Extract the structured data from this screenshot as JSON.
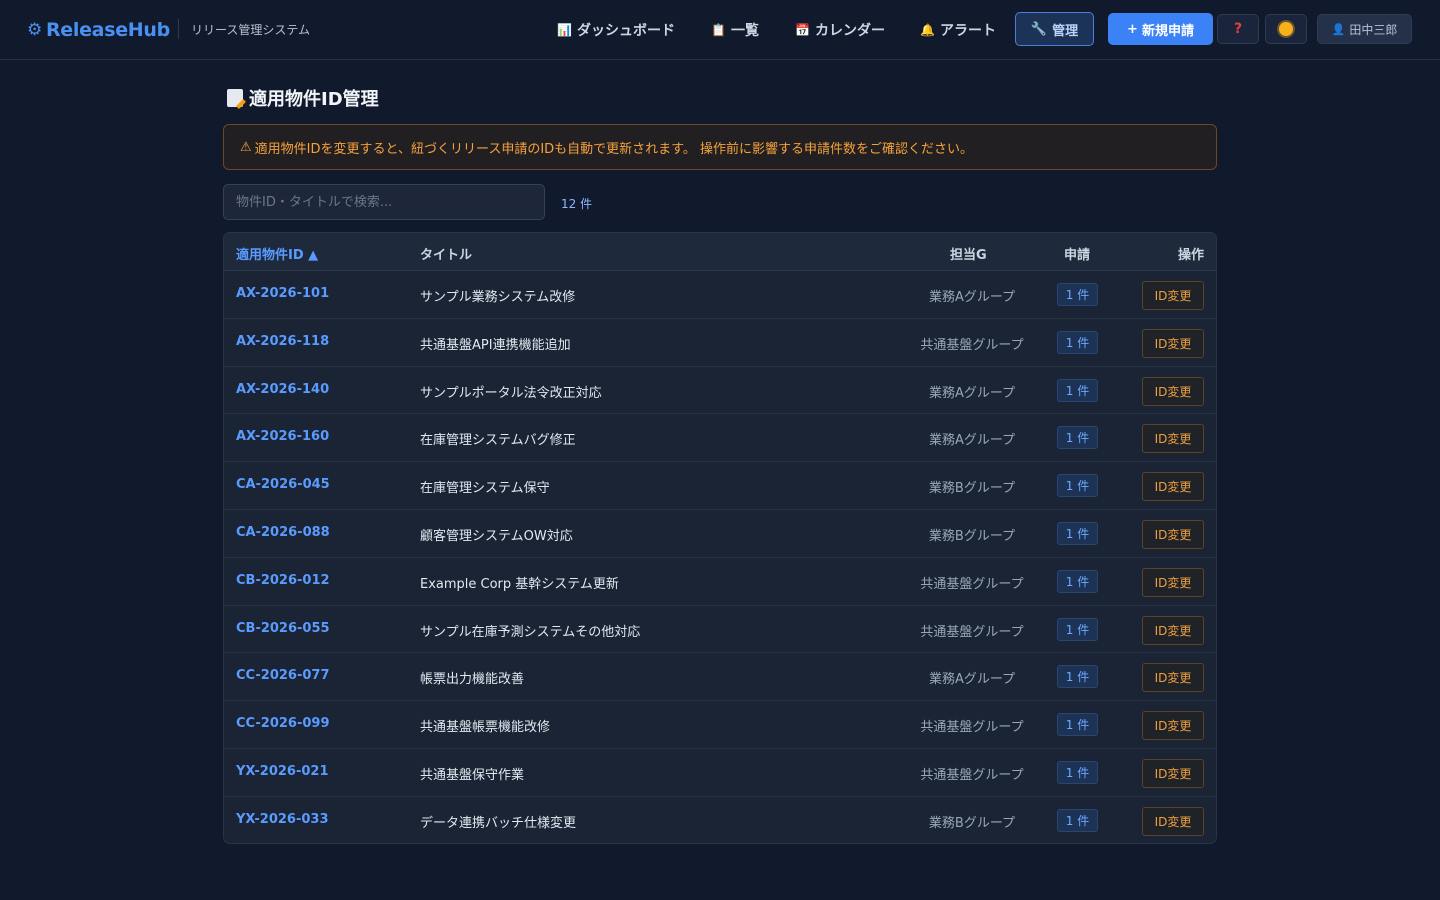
{
  "header": {
    "brand": "ReleaseHub",
    "brand_icon": "gear-icon",
    "subtitle": "リリース管理システム",
    "nav": {
      "dashboard": "ダッシュボード",
      "list": "一覧",
      "calendar": "カレンダー",
      "alert": "アラート"
    },
    "manage_label": "管理",
    "new_label": "新規申請",
    "help_label": "?",
    "user_name": "田中三郎"
  },
  "page": {
    "title": "適用物件ID管理",
    "warning": "適用物件IDを変更すると、紐づくリリース申請のIDも自動で更新されます。 操作前に影響する申請件数をご確認ください。",
    "search_placeholder": "物件ID・タイトルで検索...",
    "count": "12 件"
  },
  "table": {
    "headers": {
      "id": "適用物件ID ▲",
      "title": "タイトル",
      "group": "担当G",
      "requests": "申請",
      "actions": "操作"
    },
    "rows": [
      {
        "id": "AX-2026-101",
        "title": "サンプル業務システム改修",
        "group": "業務Aグループ",
        "requests": "1 件",
        "action": "ID変更"
      },
      {
        "id": "AX-2026-118",
        "title": "共通基盤API連携機能追加",
        "group": "共通基盤グループ",
        "requests": "1 件",
        "action": "ID変更"
      },
      {
        "id": "AX-2026-140",
        "title": "サンプルポータル法令改正対応",
        "group": "業務Aグループ",
        "requests": "1 件",
        "action": "ID変更"
      },
      {
        "id": "AX-2026-160",
        "title": "在庫管理システムバグ修正",
        "group": "業務Aグループ",
        "requests": "1 件",
        "action": "ID変更"
      },
      {
        "id": "CA-2026-045",
        "title": "在庫管理システム保守",
        "group": "業務Bグループ",
        "requests": "1 件",
        "action": "ID変更"
      },
      {
        "id": "CA-2026-088",
        "title": "顧客管理システムOW対応",
        "group": "業務Bグループ",
        "requests": "1 件",
        "action": "ID変更"
      },
      {
        "id": "CB-2026-012",
        "title": "Example Corp 基幹システム更新",
        "group": "共通基盤グループ",
        "requests": "1 件",
        "action": "ID変更"
      },
      {
        "id": "CB-2026-055",
        "title": "サンプル在庫予測システムその他対応",
        "group": "共通基盤グループ",
        "requests": "1 件",
        "action": "ID変更"
      },
      {
        "id": "CC-2026-077",
        "title": "帳票出力機能改善",
        "group": "業務Aグループ",
        "requests": "1 件",
        "action": "ID変更"
      },
      {
        "id": "CC-2026-099",
        "title": "共通基盤帳票機能改修",
        "group": "共通基盤グループ",
        "requests": "1 件",
        "action": "ID変更"
      },
      {
        "id": "YX-2026-021",
        "title": "共通基盤保守作業",
        "group": "共通基盤グループ",
        "requests": "1 件",
        "action": "ID変更"
      },
      {
        "id": "YX-2026-033",
        "title": "データ連携バッチ仕様変更",
        "group": "業務Bグループ",
        "requests": "1 件",
        "action": "ID変更"
      }
    ]
  },
  "colors": {
    "background": "#111a2c",
    "accent": "#3b82f6",
    "link": "#5a9bff",
    "warning": "#f6a23b"
  }
}
